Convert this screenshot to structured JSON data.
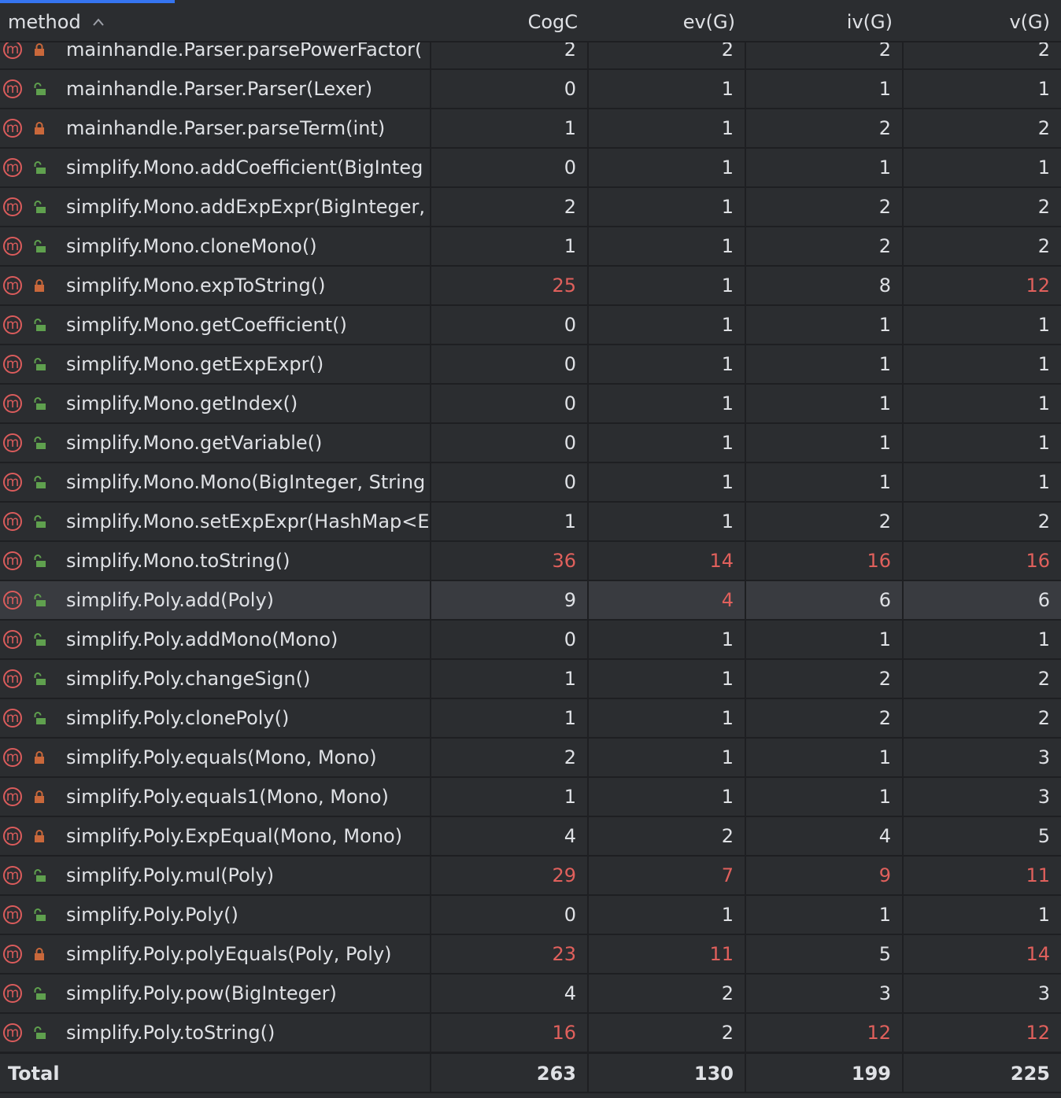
{
  "header": {
    "method": "method",
    "sort_glyph": "^",
    "cols": [
      "CogC",
      "ev(G)",
      "iv(G)",
      "v(G)"
    ]
  },
  "colors": {
    "accent": "#3574f0",
    "hot": "#e0605c",
    "method_icon": "#db5c5c",
    "lock_private": "#c9683b",
    "lock_public": "#5fa04e"
  },
  "rows": [
    {
      "name": "mainhandle.Parser.parsePowerFactor(",
      "access": "private",
      "v": [
        "2",
        "2",
        "2",
        "2"
      ],
      "hot": [
        false,
        false,
        false,
        false
      ]
    },
    {
      "name": "mainhandle.Parser.Parser(Lexer)",
      "access": "public",
      "v": [
        "0",
        "1",
        "1",
        "1"
      ],
      "hot": [
        false,
        false,
        false,
        false
      ]
    },
    {
      "name": "mainhandle.Parser.parseTerm(int)",
      "access": "private",
      "v": [
        "1",
        "1",
        "2",
        "2"
      ],
      "hot": [
        false,
        false,
        false,
        false
      ]
    },
    {
      "name": "simplify.Mono.addCoefficient(BigInteg",
      "access": "public",
      "v": [
        "0",
        "1",
        "1",
        "1"
      ],
      "hot": [
        false,
        false,
        false,
        false
      ]
    },
    {
      "name": "simplify.Mono.addExpExpr(BigInteger,",
      "access": "public",
      "v": [
        "2",
        "1",
        "2",
        "2"
      ],
      "hot": [
        false,
        false,
        false,
        false
      ]
    },
    {
      "name": "simplify.Mono.cloneMono()",
      "access": "public",
      "v": [
        "1",
        "1",
        "2",
        "2"
      ],
      "hot": [
        false,
        false,
        false,
        false
      ]
    },
    {
      "name": "simplify.Mono.expToString()",
      "access": "private",
      "v": [
        "25",
        "1",
        "8",
        "12"
      ],
      "hot": [
        true,
        false,
        false,
        true
      ]
    },
    {
      "name": "simplify.Mono.getCoefficient()",
      "access": "public",
      "v": [
        "0",
        "1",
        "1",
        "1"
      ],
      "hot": [
        false,
        false,
        false,
        false
      ]
    },
    {
      "name": "simplify.Mono.getExpExpr()",
      "access": "public",
      "v": [
        "0",
        "1",
        "1",
        "1"
      ],
      "hot": [
        false,
        false,
        false,
        false
      ]
    },
    {
      "name": "simplify.Mono.getIndex()",
      "access": "public",
      "v": [
        "0",
        "1",
        "1",
        "1"
      ],
      "hot": [
        false,
        false,
        false,
        false
      ]
    },
    {
      "name": "simplify.Mono.getVariable()",
      "access": "public",
      "v": [
        "0",
        "1",
        "1",
        "1"
      ],
      "hot": [
        false,
        false,
        false,
        false
      ]
    },
    {
      "name": "simplify.Mono.Mono(BigInteger, String",
      "access": "public",
      "v": [
        "0",
        "1",
        "1",
        "1"
      ],
      "hot": [
        false,
        false,
        false,
        false
      ]
    },
    {
      "name": "simplify.Mono.setExpExpr(HashMap<E",
      "access": "public",
      "v": [
        "1",
        "1",
        "2",
        "2"
      ],
      "hot": [
        false,
        false,
        false,
        false
      ]
    },
    {
      "name": "simplify.Mono.toString()",
      "access": "public",
      "v": [
        "36",
        "14",
        "16",
        "16"
      ],
      "hot": [
        true,
        true,
        true,
        true
      ]
    },
    {
      "name": "simplify.Poly.add(Poly)",
      "access": "public",
      "v": [
        "9",
        "4",
        "6",
        "6"
      ],
      "hot": [
        false,
        true,
        false,
        false
      ],
      "selected": true
    },
    {
      "name": "simplify.Poly.addMono(Mono)",
      "access": "public",
      "v": [
        "0",
        "1",
        "1",
        "1"
      ],
      "hot": [
        false,
        false,
        false,
        false
      ]
    },
    {
      "name": "simplify.Poly.changeSign()",
      "access": "public",
      "v": [
        "1",
        "1",
        "2",
        "2"
      ],
      "hot": [
        false,
        false,
        false,
        false
      ]
    },
    {
      "name": "simplify.Poly.clonePoly()",
      "access": "public",
      "v": [
        "1",
        "1",
        "2",
        "2"
      ],
      "hot": [
        false,
        false,
        false,
        false
      ]
    },
    {
      "name": "simplify.Poly.equals(Mono, Mono)",
      "access": "private",
      "v": [
        "2",
        "1",
        "1",
        "3"
      ],
      "hot": [
        false,
        false,
        false,
        false
      ]
    },
    {
      "name": "simplify.Poly.equals1(Mono, Mono)",
      "access": "private",
      "v": [
        "1",
        "1",
        "1",
        "3"
      ],
      "hot": [
        false,
        false,
        false,
        false
      ]
    },
    {
      "name": "simplify.Poly.ExpEqual(Mono, Mono)",
      "access": "private",
      "v": [
        "4",
        "2",
        "4",
        "5"
      ],
      "hot": [
        false,
        false,
        false,
        false
      ]
    },
    {
      "name": "simplify.Poly.mul(Poly)",
      "access": "public",
      "v": [
        "29",
        "7",
        "9",
        "11"
      ],
      "hot": [
        true,
        true,
        true,
        true
      ]
    },
    {
      "name": "simplify.Poly.Poly()",
      "access": "public",
      "v": [
        "0",
        "1",
        "1",
        "1"
      ],
      "hot": [
        false,
        false,
        false,
        false
      ]
    },
    {
      "name": "simplify.Poly.polyEquals(Poly, Poly)",
      "access": "private",
      "v": [
        "23",
        "11",
        "5",
        "14"
      ],
      "hot": [
        true,
        true,
        false,
        true
      ]
    },
    {
      "name": "simplify.Poly.pow(BigInteger)",
      "access": "public",
      "v": [
        "4",
        "2",
        "3",
        "3"
      ],
      "hot": [
        false,
        false,
        false,
        false
      ]
    },
    {
      "name": "simplify.Poly.toString()",
      "access": "public",
      "v": [
        "16",
        "2",
        "12",
        "12"
      ],
      "hot": [
        true,
        false,
        true,
        true
      ]
    }
  ],
  "total": {
    "label": "Total",
    "v": [
      "263",
      "130",
      "199",
      "225"
    ]
  },
  "icons": {
    "method": "method-m-icon",
    "private": "lock-closed-icon",
    "public": "lock-open-icon"
  },
  "method_icon_glyph": "m"
}
